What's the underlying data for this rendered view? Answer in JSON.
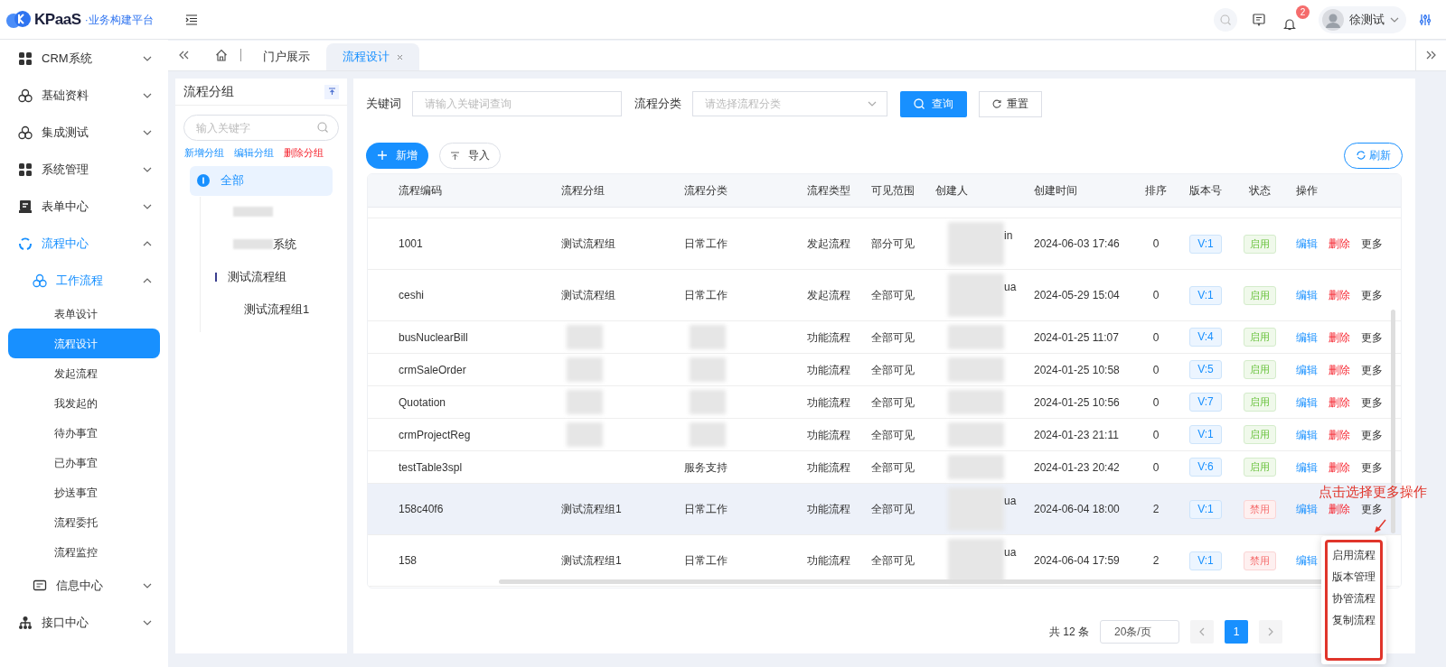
{
  "brand": {
    "name": "KPaaS",
    "subtitle": "·业务构建平台"
  },
  "header": {
    "notifications": "2",
    "user": "徐测试"
  },
  "sidebar": {
    "items": [
      {
        "label": "CRM系统",
        "expanded": false,
        "active": false
      },
      {
        "label": "基础资料",
        "expanded": false,
        "active": false
      },
      {
        "label": "集成测试",
        "expanded": false,
        "active": false
      },
      {
        "label": "系统管理",
        "expanded": false,
        "active": false
      },
      {
        "label": "表单中心",
        "expanded": false,
        "active": false
      },
      {
        "label": "流程中心",
        "expanded": true,
        "active": true,
        "children": [
          {
            "label": "工作流程",
            "expanded": true,
            "active": true,
            "children": [
              {
                "label": "表单设计",
                "selected": false
              },
              {
                "label": "流程设计",
                "selected": true
              },
              {
                "label": "发起流程",
                "selected": false
              },
              {
                "label": "我发起的",
                "selected": false
              },
              {
                "label": "待办事宜",
                "selected": false
              },
              {
                "label": "已办事宜",
                "selected": false
              },
              {
                "label": "抄送事宜",
                "selected": false
              },
              {
                "label": "流程委托",
                "selected": false
              },
              {
                "label": "流程监控",
                "selected": false
              }
            ]
          },
          {
            "label": "信息中心",
            "expanded": false,
            "active": false
          }
        ]
      },
      {
        "label": "接口中心",
        "expanded": false,
        "active": false
      }
    ]
  },
  "tabs": [
    {
      "label": "门户展示",
      "selected": false,
      "closable": false
    },
    {
      "label": "流程设计",
      "selected": true,
      "closable": true
    }
  ],
  "group_panel": {
    "title": "流程分组",
    "search_placeholder": "输入关键字",
    "actions": [
      {
        "label": "新增分组",
        "kind": "normal"
      },
      {
        "label": "编辑分组",
        "kind": "normal"
      },
      {
        "label": "删除分组",
        "kind": "danger"
      }
    ],
    "tree": [
      {
        "label": "全部",
        "selected": true,
        "children": [
          {
            "blurred": true,
            "selected": false
          },
          {
            "label": "系统",
            "blurred": true,
            "selected": false
          },
          {
            "label": "测试流程组",
            "selected": false,
            "children": [
              {
                "label": "测试流程组1",
                "selected": false
              }
            ]
          }
        ]
      }
    ]
  },
  "filters": {
    "keyword_label": "关键词",
    "keyword_placeholder": "请输入关键词查询",
    "category_label": "流程分类",
    "category_placeholder": "请选择流程分类",
    "search_button": "查询",
    "reset_button": "重置"
  },
  "toolbar": {
    "add_button": "新增",
    "import_button": "导入",
    "refresh_button": "刷新"
  },
  "table": {
    "columns": [
      "流程编码",
      "流程分组",
      "流程分类",
      "流程类型",
      "可见范围",
      "创建人",
      "创建时间",
      "排序",
      "版本号",
      "状态",
      "操作"
    ],
    "rows": [
      {
        "code": "1001",
        "group": "测试流程组",
        "category": "日常工作",
        "type": "发起流程",
        "scope": "部分可见",
        "creator": "in",
        "creator_blurred": true,
        "time": "2024-06-03 17:46",
        "order": "0",
        "version": "V:1",
        "status": "启用",
        "enabled": true,
        "tall": true,
        "hover": false,
        "actions": [
          "编辑",
          "删除",
          "更多"
        ]
      },
      {
        "code": "ceshi",
        "group": "测试流程组",
        "category": "日常工作",
        "type": "发起流程",
        "scope": "全部可见",
        "creator": "ua",
        "creator_blurred": true,
        "time": "2024-05-29 15:04",
        "order": "0",
        "version": "V:1",
        "status": "启用",
        "enabled": true,
        "tall": true,
        "hover": false,
        "actions": [
          "编辑",
          "删除",
          "更多"
        ]
      },
      {
        "code": "busNuclearBill",
        "group_blurred": true,
        "category_blurred": true,
        "type": "功能流程",
        "scope": "全部可见",
        "creator_blurred": true,
        "time": "2024-01-25 11:07",
        "order": "0",
        "version": "V:4",
        "status": "启用",
        "enabled": true,
        "tall": false,
        "hover": false,
        "actions": [
          "编辑",
          "删除",
          "更多"
        ]
      },
      {
        "code": "crmSaleOrder",
        "group_blurred": true,
        "category_blurred": true,
        "type": "功能流程",
        "scope": "全部可见",
        "creator_blurred": true,
        "time": "2024-01-25 10:58",
        "order": "0",
        "version": "V:5",
        "status": "启用",
        "enabled": true,
        "tall": false,
        "hover": false,
        "actions": [
          "编辑",
          "删除",
          "更多"
        ]
      },
      {
        "code": "Quotation",
        "group_blurred": true,
        "category_blurred": true,
        "type": "功能流程",
        "scope": "全部可见",
        "creator_blurred": true,
        "time": "2024-01-25 10:56",
        "order": "0",
        "version": "V:7",
        "status": "启用",
        "enabled": true,
        "tall": false,
        "hover": false,
        "actions": [
          "编辑",
          "删除",
          "更多"
        ]
      },
      {
        "code": "crmProjectReg",
        "group_blurred": true,
        "category_blurred": true,
        "type": "功能流程",
        "scope": "全部可见",
        "creator_blurred": true,
        "time": "2024-01-23 21:11",
        "order": "0",
        "version": "V:1",
        "status": "启用",
        "enabled": true,
        "tall": false,
        "hover": false,
        "actions": [
          "编辑",
          "删除",
          "更多"
        ]
      },
      {
        "code": "testTable3spl",
        "category": "服务支持",
        "type": "功能流程",
        "scope": "全部可见",
        "creator_blurred": true,
        "time": "2024-01-23 20:42",
        "order": "0",
        "version": "V:6",
        "status": "启用",
        "enabled": true,
        "tall": false,
        "hover": false,
        "actions": [
          "编辑",
          "删除",
          "更多"
        ]
      },
      {
        "code": "158c40f6",
        "group": "测试流程组1",
        "category": "日常工作",
        "type": "功能流程",
        "scope": "全部可见",
        "creator": "ua",
        "creator_blurred": true,
        "time": "2024-06-04 18:00",
        "order": "2",
        "version": "V:1",
        "status": "禁用",
        "enabled": false,
        "tall": true,
        "hover": true,
        "actions": [
          "编辑",
          "删除",
          "更多"
        ]
      },
      {
        "code": "158",
        "group": "测试流程组1",
        "category": "日常工作",
        "type": "功能流程",
        "scope": "全部可见",
        "creator": "ua",
        "creator_blurred": true,
        "time": "2024-06-04 17:59",
        "order": "2",
        "version": "V:1",
        "status": "禁用",
        "enabled": false,
        "tall": true,
        "hover": false,
        "actions": [
          "编辑"
        ]
      }
    ]
  },
  "more_menu": {
    "items": [
      "启用流程",
      "版本管理",
      "协管流程",
      "复制流程"
    ]
  },
  "annotation": {
    "text": "点击选择更多操作"
  },
  "pagination": {
    "total": "共 12 条",
    "page_size": "20条/页",
    "pages": [
      {
        "label": "1",
        "selected": true
      }
    ]
  }
}
